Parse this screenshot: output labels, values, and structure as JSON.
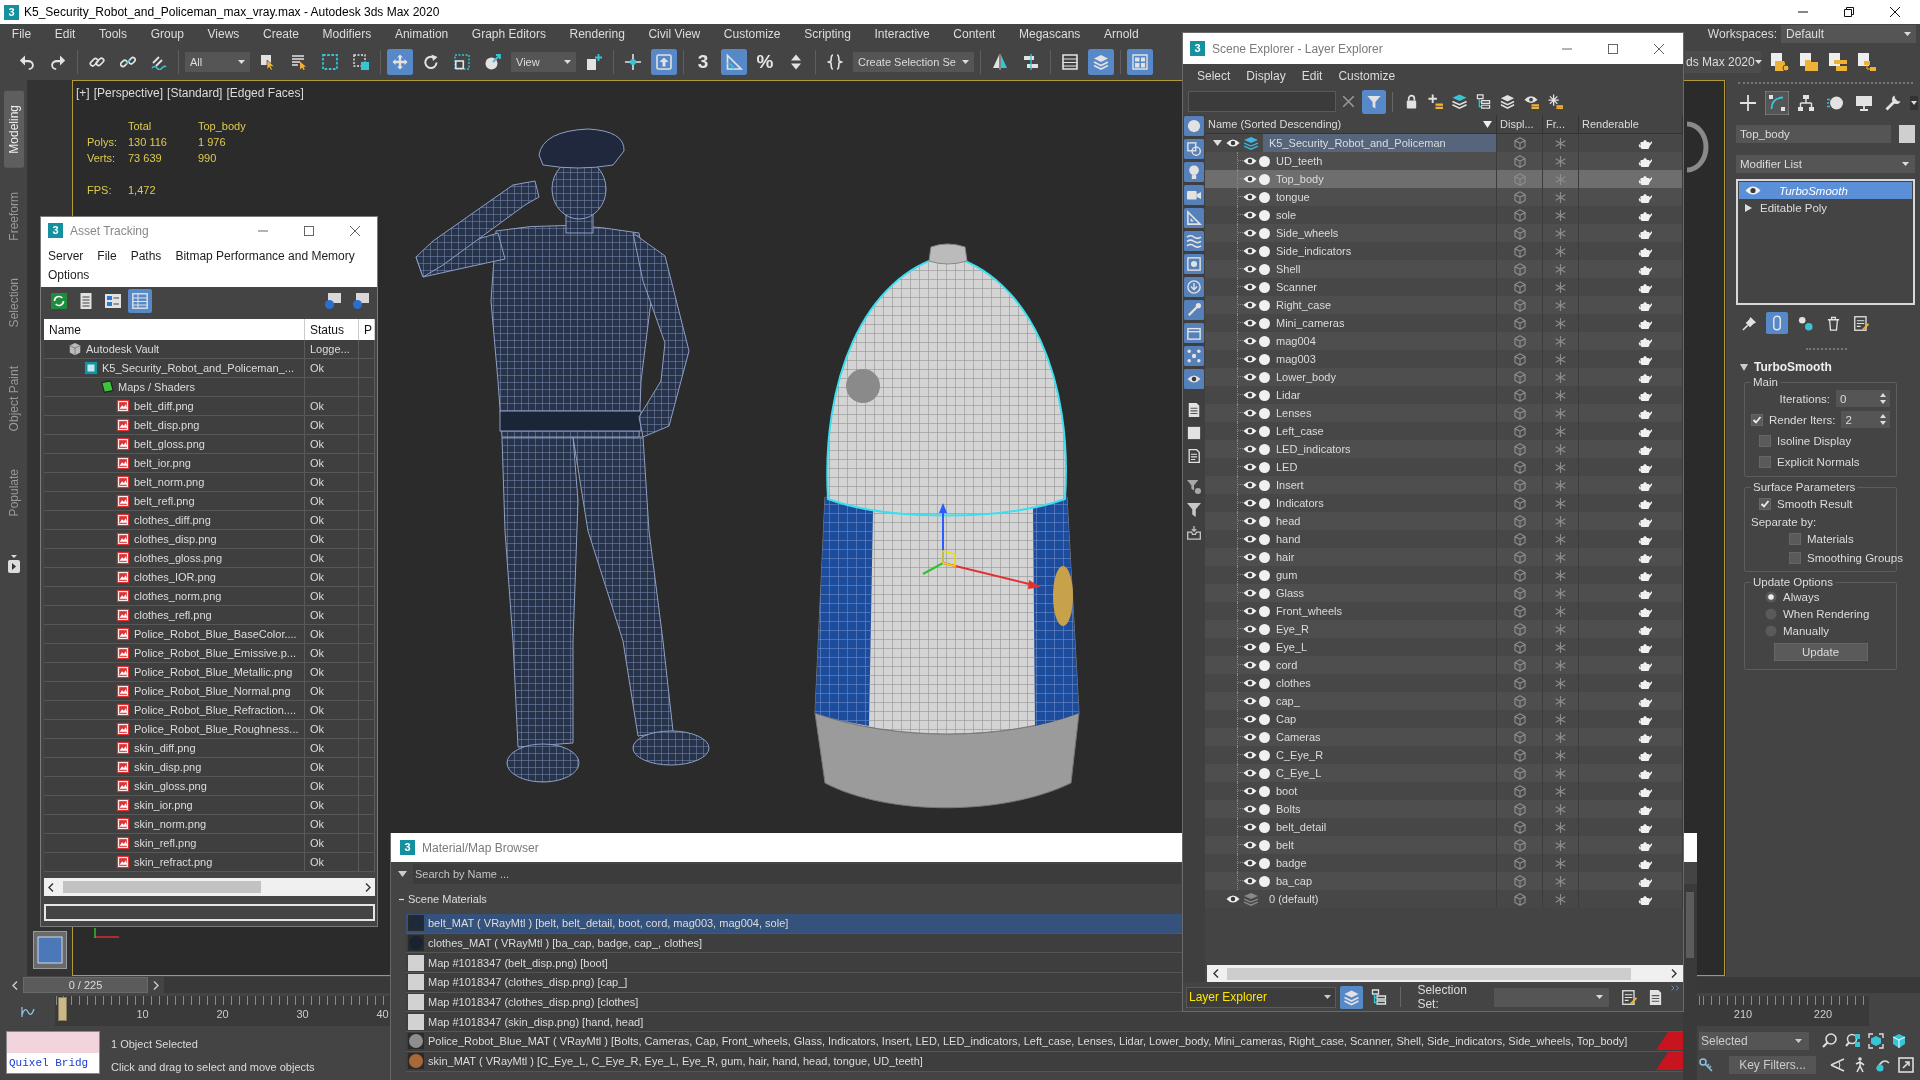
{
  "window": {
    "logo": "3",
    "title": "K5_Security_Robot_and_Policeman_max_vray.max - Autodesk 3ds Max 2020"
  },
  "menu": [
    "File",
    "Edit",
    "Tools",
    "Group",
    "Views",
    "Create",
    "Modifiers",
    "Animation",
    "Graph Editors",
    "Rendering",
    "Civil View",
    "Customize",
    "Scripting",
    "Interactive",
    "Content",
    "Megascans",
    "Arnold"
  ],
  "workspaces": {
    "label": "Workspaces:",
    "value": "Default"
  },
  "toolbar": [
    [
      {
        "kind": "undo",
        "active": false
      },
      {
        "kind": "redo",
        "active": false
      }
    ],
    [
      {
        "kind": "link",
        "active": false
      },
      {
        "kind": "unlink",
        "active": false
      },
      {
        "kind": "bind",
        "active": false
      }
    ],
    [
      {
        "kind": "dropdown",
        "value": "All"
      },
      {
        "kind": "select",
        "active": false
      },
      {
        "kind": "selname",
        "active": false
      },
      {
        "kind": "region",
        "active": false
      },
      {
        "kind": "crossing",
        "active": false
      }
    ],
    [
      {
        "kind": "move",
        "active": true
      },
      {
        "kind": "rotate",
        "active": false
      },
      {
        "kind": "scale",
        "active": false
      },
      {
        "kind": "place",
        "active": false
      },
      {
        "kind": "dropdown",
        "value": "View"
      },
      {
        "kind": "pivot",
        "active": false
      }
    ],
    [
      {
        "kind": "manipulate",
        "active": false
      },
      {
        "kind": "override",
        "active": true
      }
    ],
    [
      {
        "kind": "snap",
        "label": "3",
        "active": false
      },
      {
        "kind": "angle",
        "active": true
      },
      {
        "kind": "percent",
        "label": "%",
        "active": false
      },
      {
        "kind": "spinner",
        "active": false
      }
    ],
    [
      {
        "kind": "namedsel",
        "active": false
      },
      {
        "kind": "dropdown",
        "value": "Create Selection Se"
      }
    ],
    [
      {
        "kind": "mirror",
        "active": false
      },
      {
        "kind": "align",
        "active": false
      }
    ],
    [
      {
        "kind": "table",
        "active": false
      },
      {
        "kind": "layers",
        "active": true
      }
    ],
    [
      {
        "kind": "ribbon",
        "active": true
      }
    ]
  ],
  "project": {
    "value": "ds Max 2020"
  },
  "ribbon": [
    {
      "label": "Modeling",
      "selected": true
    },
    {
      "label": "Freeform",
      "selected": false
    },
    {
      "label": "Selection",
      "selected": false
    },
    {
      "label": "Object Paint",
      "selected": false
    },
    {
      "label": "Populate",
      "selected": false
    }
  ],
  "viewport": {
    "labels": [
      "[+]",
      "[Perspective]",
      "[Standard]",
      "[Edged Faces]"
    ],
    "stats": {
      "columns": [
        "Total",
        "Top_body"
      ],
      "rows": [
        {
          "label": "Polys:",
          "values": [
            "130 116",
            "1 976"
          ]
        },
        {
          "label": "Verts:",
          "values": [
            "73 639",
            "990"
          ]
        }
      ],
      "fps": {
        "label": "FPS:",
        "value": "1,472"
      }
    }
  },
  "asset_tracking": {
    "logo": "3",
    "title": "Asset Tracking",
    "menu": [
      "Server",
      "File",
      "Paths",
      "Bitmap Performance and Memory",
      "Options"
    ],
    "toolbar": [
      {
        "kind": "refresh",
        "active": false
      },
      {
        "kind": "list",
        "active": false
      },
      {
        "kind": "thumbs",
        "active": false
      },
      {
        "kind": "grid",
        "active": true
      }
    ],
    "columns": [
      "Name",
      "Status",
      "P"
    ],
    "tree": [
      {
        "kind": "vault",
        "name": "Autodesk Vault",
        "status": "Logge...",
        "children": [
          {
            "kind": "scene",
            "name": "K5_Security_Robot_and_Policeman_...",
            "status": "Ok",
            "children": [
              {
                "kind": "folder",
                "name": "Maps / Shaders",
                "children": [
                  {
                    "kind": "bitmap",
                    "name": "belt_diff.png",
                    "status": "Ok"
                  },
                  {
                    "kind": "bitmap",
                    "name": "belt_disp.png",
                    "status": "Ok"
                  },
                  {
                    "kind": "bitmap",
                    "name": "belt_gloss.png",
                    "status": "Ok"
                  },
                  {
                    "kind": "bitmap",
                    "name": "belt_ior.png",
                    "status": "Ok"
                  },
                  {
                    "kind": "bitmap",
                    "name": "belt_norm.png",
                    "status": "Ok"
                  },
                  {
                    "kind": "bitmap",
                    "name": "belt_refl.png",
                    "status": "Ok"
                  },
                  {
                    "kind": "bitmap",
                    "name": "clothes_diff.png",
                    "status": "Ok"
                  },
                  {
                    "kind": "bitmap",
                    "name": "clothes_disp.png",
                    "status": "Ok"
                  },
                  {
                    "kind": "bitmap",
                    "name": "clothes_gloss.png",
                    "status": "Ok"
                  },
                  {
                    "kind": "bitmap",
                    "name": "clothes_IOR.png",
                    "status": "Ok"
                  },
                  {
                    "kind": "bitmap",
                    "name": "clothes_norm.png",
                    "status": "Ok"
                  },
                  {
                    "kind": "bitmap",
                    "name": "clothes_refl.png",
                    "status": "Ok"
                  },
                  {
                    "kind": "bitmap",
                    "name": "Police_Robot_Blue_BaseColor....",
                    "status": "Ok"
                  },
                  {
                    "kind": "bitmap",
                    "name": "Police_Robot_Blue_Emissive.p...",
                    "status": "Ok"
                  },
                  {
                    "kind": "bitmap",
                    "name": "Police_Robot_Blue_Metallic.png",
                    "status": "Ok"
                  },
                  {
                    "kind": "bitmap",
                    "name": "Police_Robot_Blue_Normal.png",
                    "status": "Ok"
                  },
                  {
                    "kind": "bitmap",
                    "name": "Police_Robot_Blue_Refraction....",
                    "status": "Ok"
                  },
                  {
                    "kind": "bitmap",
                    "name": "Police_Robot_Blue_Roughness...",
                    "status": "Ok"
                  },
                  {
                    "kind": "bitmap",
                    "name": "skin_diff.png",
                    "status": "Ok"
                  },
                  {
                    "kind": "bitmap",
                    "name": "skin_disp.png",
                    "status": "Ok"
                  },
                  {
                    "kind": "bitmap",
                    "name": "skin_gloss.png",
                    "status": "Ok"
                  },
                  {
                    "kind": "bitmap",
                    "name": "skin_ior.png",
                    "status": "Ok"
                  },
                  {
                    "kind": "bitmap",
                    "name": "skin_norm.png",
                    "status": "Ok"
                  },
                  {
                    "kind": "bitmap",
                    "name": "skin_refl.png",
                    "status": "Ok"
                  },
                  {
                    "kind": "bitmap",
                    "name": "skin_refract.png",
                    "status": "Ok"
                  }
                ]
              }
            ]
          }
        ]
      }
    ]
  },
  "scene_explorer": {
    "logo": "3",
    "title": "Scene Explorer - Layer Explorer",
    "menu": [
      "Select",
      "Display",
      "Edit",
      "Customize"
    ],
    "toolbar": [
      {
        "kind": "filter",
        "active": true
      },
      {
        "kind": "lock",
        "active": false
      },
      {
        "kind": "addlayer",
        "active": false
      },
      {
        "kind": "addsel",
        "active": false
      },
      {
        "kind": "hierarchy",
        "active": false
      },
      {
        "kind": "layers",
        "active": false
      },
      {
        "kind": "hide",
        "active": false
      },
      {
        "kind": "freeze",
        "active": false
      }
    ],
    "sidebar": [
      {
        "kind": "geometry",
        "active": true
      },
      {
        "kind": "shapes",
        "active": true
      },
      {
        "kind": "lights",
        "active": true
      },
      {
        "kind": "cameras",
        "active": true
      },
      {
        "kind": "helpers",
        "active": true
      },
      {
        "kind": "warps",
        "active": true
      },
      {
        "kind": "groups",
        "active": true
      },
      {
        "kind": "xrefs",
        "active": true
      },
      {
        "kind": "bones",
        "active": true
      },
      {
        "kind": "containers",
        "active": true
      },
      {
        "kind": "particles",
        "active": true
      },
      {
        "kind": "hidden",
        "active": true
      },
      {
        "kind": "all",
        "active": false
      },
      {
        "kind": "none",
        "active": false
      },
      {
        "kind": "invert",
        "active": false
      },
      {
        "kind": "filterset",
        "active": false
      },
      {
        "kind": "funnel",
        "active": false
      },
      {
        "kind": "tray",
        "active": false
      }
    ],
    "columns": [
      "Name (Sorted Descending)",
      "Displ...",
      "Fr...",
      "Renderable"
    ],
    "layers": [
      {
        "name": "K5_Security_Robot_and_Policeman",
        "expanded": true,
        "active": true,
        "selected": false,
        "children": [
          {
            "name": "UD_teeth",
            "selected": false
          },
          {
            "name": "Top_body",
            "selected": true
          },
          {
            "name": "tongue",
            "selected": false
          },
          {
            "name": "sole",
            "selected": false
          },
          {
            "name": "Side_wheels",
            "selected": false
          },
          {
            "name": "Side_indicators",
            "selected": false
          },
          {
            "name": "Shell",
            "selected": false
          },
          {
            "name": "Scanner",
            "selected": false
          },
          {
            "name": "Right_case",
            "selected": false
          },
          {
            "name": "Mini_cameras",
            "selected": false
          },
          {
            "name": "mag004",
            "selected": false
          },
          {
            "name": "mag003",
            "selected": false
          },
          {
            "name": "Lower_body",
            "selected": false
          },
          {
            "name": "Lidar",
            "selected": false
          },
          {
            "name": "Lenses",
            "selected": false
          },
          {
            "name": "Left_case",
            "selected": false
          },
          {
            "name": "LED_indicators",
            "selected": false
          },
          {
            "name": "LED",
            "selected": false
          },
          {
            "name": "Insert",
            "selected": false
          },
          {
            "name": "Indicators",
            "selected": false
          },
          {
            "name": "head",
            "selected": false
          },
          {
            "name": "hand",
            "selected": false
          },
          {
            "name": "hair",
            "selected": false
          },
          {
            "name": "gum",
            "selected": false
          },
          {
            "name": "Glass",
            "selected": false
          },
          {
            "name": "Front_wheels",
            "selected": false
          },
          {
            "name": "Eye_R",
            "selected": false
          },
          {
            "name": "Eye_L",
            "selected": false
          },
          {
            "name": "cord",
            "selected": false
          },
          {
            "name": "clothes",
            "selected": false
          },
          {
            "name": "cap_",
            "selected": false
          },
          {
            "name": "Cap",
            "selected": false
          },
          {
            "name": "Cameras",
            "selected": false
          },
          {
            "name": "C_Eye_R",
            "selected": false
          },
          {
            "name": "C_Eye_L",
            "selected": false
          },
          {
            "name": "boot",
            "selected": false
          },
          {
            "name": "Bolts",
            "selected": false
          },
          {
            "name": "belt_detail",
            "selected": false
          },
          {
            "name": "belt",
            "selected": false
          },
          {
            "name": "badge",
            "selected": false
          },
          {
            "name": "ba_cap",
            "selected": false
          }
        ]
      },
      {
        "name": "0 (default)",
        "expanded": false,
        "active": false,
        "selected": false
      }
    ],
    "footer": {
      "mode": "Layer Explorer",
      "views": [
        {
          "kind": "layers",
          "active": true
        },
        {
          "kind": "hierarchy",
          "active": false
        }
      ],
      "selection_set_label": "Selection Set:"
    }
  },
  "command_panel": {
    "tabs": [
      {
        "kind": "create",
        "selected": false
      },
      {
        "kind": "modify",
        "selected": true
      },
      {
        "kind": "hier",
        "selected": false
      },
      {
        "kind": "motion",
        "selected": false
      },
      {
        "kind": "display",
        "selected": false
      },
      {
        "kind": "utilities",
        "selected": false
      }
    ],
    "object_name": "Top_body",
    "modifier_list": "Modifier List",
    "stack": [
      {
        "kind": "modifier",
        "name": "TurboSmooth",
        "selected": true,
        "on": true
      },
      {
        "kind": "base",
        "name": "Editable Poly",
        "selected": false,
        "expanded": false
      }
    ],
    "stack_tools": [
      {
        "kind": "pin",
        "active": false
      },
      {
        "kind": "endresult",
        "active": true
      },
      {
        "kind": "unique",
        "active": false
      },
      {
        "kind": "remove",
        "active": false
      },
      {
        "kind": "configure",
        "active": false
      }
    ],
    "rollout": {
      "title": "TurboSmooth",
      "expanded": true,
      "groups": [
        {
          "title": "Main",
          "controls": [
            {
              "kind": "spinner",
              "label": "Iterations:",
              "value": "0"
            },
            {
              "kind": "checkspinner",
              "label": "Render Iters:",
              "value": "2",
              "checked": true
            },
            {
              "kind": "checkbox",
              "label": "Isoline Display",
              "checked": false
            },
            {
              "kind": "checkbox",
              "label": "Explicit Normals",
              "checked": false
            }
          ]
        },
        {
          "title": "Surface Parameters",
          "controls": [
            {
              "kind": "checkbox",
              "label": "Smooth Result",
              "checked": true
            },
            {
              "kind": "heading",
              "label": "Separate by:",
              "children": [
                {
                  "kind": "checkbox",
                  "label": "Materials",
                  "checked": false
                },
                {
                  "kind": "checkbox",
                  "label": "Smoothing Groups",
                  "checked": false
                }
              ]
            }
          ]
        },
        {
          "title": "Update Options",
          "controls": [
            {
              "kind": "radio",
              "label": "Always",
              "selected": true
            },
            {
              "kind": "radio",
              "label": "When Rendering",
              "selected": false
            },
            {
              "kind": "radio",
              "label": "Manually",
              "selected": false
            },
            {
              "kind": "button",
              "label": "Update"
            }
          ]
        }
      ]
    }
  },
  "material_browser": {
    "logo": "3",
    "title": "Material/Map Browser",
    "search": {
      "placeholder": "Search by Name ..."
    },
    "groups": [
      {
        "title": "Scene Materials",
        "expanded": true,
        "items": [
          {
            "kind": "material",
            "color": "#1c2a3c",
            "text": "belt_MAT ( VRayMtl ) [belt, belt_detail, boot, cord, mag003, mag004, sole]",
            "selected": true,
            "marked": false
          },
          {
            "kind": "material",
            "color": "#1a2231",
            "text": "clothes_MAT ( VRayMtl ) [ba_cap, badge, cap_, clothes]",
            "selected": false,
            "marked": false
          },
          {
            "kind": "map",
            "color": "#d2d2d2",
            "text": "Map #1018347 (belt_disp.png) [boot]",
            "selected": false,
            "marked": false
          },
          {
            "kind": "map",
            "color": "#d2d2d2",
            "text": "Map #1018347 (clothes_disp.png) [cap_]",
            "selected": false,
            "marked": false
          },
          {
            "kind": "map",
            "color": "#d2d2d2",
            "text": "Map #1018347 (clothes_disp.png) [clothes]",
            "selected": false,
            "marked": false
          },
          {
            "kind": "map",
            "color": "#d2d2d2",
            "text": "Map #1018347 (skin_disp.png) [hand, head]",
            "selected": false,
            "marked": false
          },
          {
            "kind": "material",
            "color": "#8e8e8e",
            "text": "Police_Robot_Blue_MAT ( VRayMtl ) [Bolts, Cameras, Cap, Front_wheels, Glass, Indicators, Insert, LED, LED_indicators, Left_case, Lenses, Lidar, Lower_body, Mini_cameras, Right_case, Scanner, Shell, Side_indicators, Side_wheels, Top_body]",
            "selected": false,
            "marked": true
          },
          {
            "kind": "material",
            "color": "#a8683a",
            "text": "skin_MAT ( VRayMtl ) [C_Eye_L, C_Eye_R, Eye_L, Eye_R, gum, hair, hand, head, tongue, UD_teeth]",
            "selected": false,
            "marked": true
          }
        ]
      }
    ]
  },
  "time_slider": {
    "value": "0 / 225"
  },
  "trackbar": {
    "start_labels": [
      "10",
      "20",
      "30",
      "40"
    ],
    "end_labels": [
      "210",
      "220"
    ]
  },
  "status": {
    "listener": "Quixel Bridg",
    "selection": "1 Object Selected",
    "prompt": "Click and drag to select and move objects"
  },
  "key_controls": {
    "key_mode": "Selected",
    "key_filters": "Key Filters..."
  }
}
